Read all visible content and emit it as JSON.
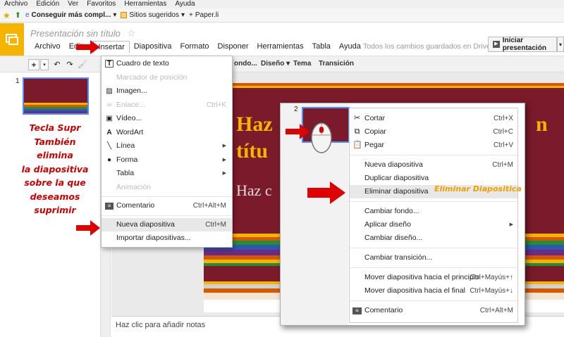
{
  "ie": {
    "menu": [
      "Archivo",
      "Edición",
      "Ver",
      "Favoritos",
      "Herramientas",
      "Ayuda"
    ],
    "favorites": [
      "Conseguir más compl...",
      "Sitios sugeridos",
      "Paper.li"
    ]
  },
  "docs": {
    "title": "Presentación sin título",
    "menu": [
      "Archivo",
      "Editar",
      "Insertar",
      "Diapositiva",
      "Formato",
      "Disponer",
      "Herramientas",
      "Tabla",
      "Ayuda"
    ],
    "saved_status": "Todos los cambios guardados en Drive",
    "present_button": "Iniciar presentación"
  },
  "toolbar": {
    "labels": [
      "ondo...",
      "Diseño",
      "Tema",
      "Transición"
    ]
  },
  "filmstrip": {
    "slide_number": "1"
  },
  "slide": {
    "title_line1": "Haz",
    "title_suffix": "n",
    "title_line2": "títu",
    "subtitle": "Haz c"
  },
  "notes_placeholder": "Haz clic para añadir notas",
  "insert_menu": {
    "items": [
      {
        "label": "Cuadro de texto",
        "icon": "text-box-icon",
        "shortcut": "",
        "disabled": false
      },
      {
        "label": "Marcador de posición",
        "icon": "",
        "shortcut": "",
        "disabled": true
      },
      {
        "label": "Imagen...",
        "icon": "image-icon",
        "shortcut": "",
        "disabled": false
      },
      {
        "label": "Enlace...",
        "icon": "link-icon",
        "shortcut": "Ctrl+K",
        "disabled": true
      },
      {
        "label": "Vídeo...",
        "icon": "video-icon",
        "shortcut": "",
        "disabled": false
      },
      {
        "label": "WordArt",
        "icon": "wordart-icon",
        "shortcut": "",
        "disabled": false
      },
      {
        "label": "Línea",
        "icon": "line-icon",
        "shortcut": "",
        "disabled": false
      },
      {
        "label": "Forma",
        "icon": "shape-icon",
        "shortcut": "",
        "disabled": false
      },
      {
        "label": "Tabla",
        "icon": "",
        "shortcut": "",
        "disabled": false
      },
      {
        "label": "Animación",
        "icon": "",
        "shortcut": "",
        "disabled": true
      },
      {
        "label": "Comentario",
        "icon": "comment-icon",
        "shortcut": "Ctrl+Alt+M",
        "disabled": false
      },
      {
        "label": "Nueva diapositiva",
        "icon": "",
        "shortcut": "Ctrl+M",
        "disabled": false
      },
      {
        "label": "Importar diapositivas...",
        "icon": "",
        "shortcut": "",
        "disabled": false
      }
    ]
  },
  "context": {
    "slide_number": "2",
    "items": [
      {
        "label": "Cortar",
        "shortcut": "Ctrl+X"
      },
      {
        "label": "Copiar",
        "shortcut": "Ctrl+C"
      },
      {
        "label": "Pegar",
        "shortcut": "Ctrl+V"
      },
      {
        "label": "Nueva diapositiva",
        "shortcut": "Ctrl+M"
      },
      {
        "label": "Duplicar diapositiva",
        "shortcut": ""
      },
      {
        "label": "Eliminar diapositiva",
        "shortcut": ""
      },
      {
        "label": "Cambiar fondo...",
        "shortcut": ""
      },
      {
        "label": "Aplicar diseño",
        "shortcut": ""
      },
      {
        "label": "Cambiar diseño...",
        "shortcut": ""
      },
      {
        "label": "Cambiar transición...",
        "shortcut": ""
      },
      {
        "label": "Mover diapositiva hacia el principio",
        "shortcut": "Ctrl+Mayús+↑"
      },
      {
        "label": "Mover diapositiva hacia el final",
        "shortcut": "Ctrl+Mayús+↓"
      },
      {
        "label": "Comentario",
        "shortcut": "Ctrl+Alt+M"
      }
    ]
  },
  "annotations": {
    "red_note": [
      "Tecla Supr",
      "También",
      "elimina",
      "la diapositiva",
      "sobre la que",
      "deseamos",
      "suprimir"
    ],
    "yellow_note": "Eliminar Diapositica"
  },
  "colors": {
    "slide_bg": "#7b1a2a",
    "accent": "#f4b400",
    "arrow": "#e00000",
    "annotation_red": "#d00000",
    "annotation_yellow": "#f0a000"
  }
}
